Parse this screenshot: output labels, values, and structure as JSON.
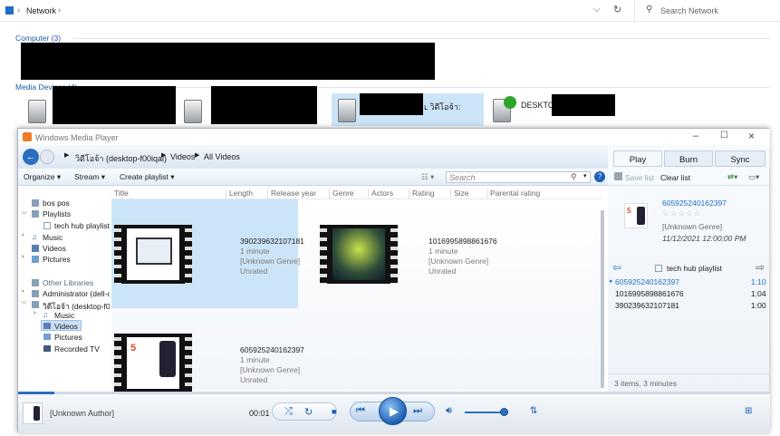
{
  "explorer": {
    "breadcrumb": [
      "Network"
    ],
    "search_placeholder": "Search Network",
    "groups": {
      "computer": "Computer (3)",
      "media": "Media Devices (4)"
    },
    "media_device_label_3": "ւ วิดีโอจ้า:",
    "media_device_label_4": "DESKTOP"
  },
  "wmp": {
    "title": "Windows Media Player",
    "breadcrumb": [
      "วิดีโอจ้า (desktop-f00iqal)",
      "Videos",
      "All Videos"
    ],
    "toolbar": {
      "organize": "Organize",
      "stream": "Stream",
      "create_playlist": "Create playlist",
      "search_placeholder": "Search"
    },
    "nav": {
      "user": "bos pos",
      "playlists": "Playlists",
      "playlist_item": "tech hub playlist",
      "music": "Music",
      "videos": "Videos",
      "pictures": "Pictures",
      "other": "Other Libraries",
      "admin": "Administrator (dell-c",
      "device": "วิดีโอจ้า (desktop-f00i",
      "d_music": "Music",
      "d_videos": "Videos",
      "d_pictures": "Pictures",
      "d_tv": "Recorded TV"
    },
    "columns": [
      "Title",
      "Length",
      "Release year",
      "Genre",
      "Actors",
      "Rating",
      "Size",
      "Parental rating"
    ],
    "videos": [
      {
        "title": "390239632107181",
        "length": "1 minute",
        "genre": "[Unknown Genre]",
        "rating": "Unrated"
      },
      {
        "title": "1016995898861676",
        "length": "1 minute",
        "genre": "[Unknown Genre]",
        "rating": "Unrated"
      },
      {
        "title": "605925240162397",
        "length": "1 minute",
        "genre": "[Unknown Genre]",
        "rating": "Unrated"
      }
    ],
    "tabs": [
      "Play",
      "Burn",
      "Sync"
    ],
    "list_actions": {
      "save": "Save list",
      "clear": "Clear list"
    },
    "now_playing": {
      "title": "605925240162397",
      "genre": "[Unknown Genre]",
      "date": "11/12/2021 12:00:00 PM"
    },
    "playlist_title": "tech hub playlist",
    "playlist": [
      {
        "name": "605925240162397",
        "dur": "1:10"
      },
      {
        "name": "1016995898861676",
        "dur": "1:04"
      },
      {
        "name": "390239632107181",
        "dur": "1:00"
      }
    ],
    "list_summary": "3 items, 3 minutes",
    "author": "[Unknown Author]",
    "time": "00:01"
  }
}
